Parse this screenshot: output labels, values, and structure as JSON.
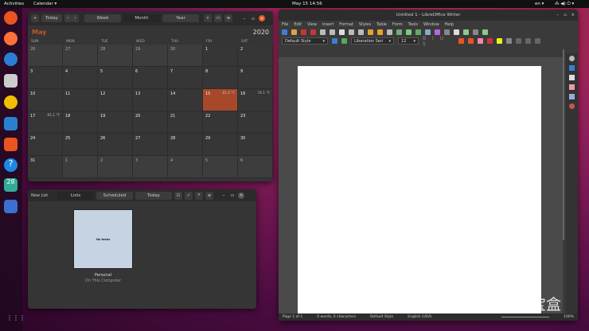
{
  "topbar": {
    "activities": "Activities",
    "app_menu": "Calendar ▾",
    "clock": "May 15  14:56",
    "lang": "en ▾",
    "system_icons": "⁂ ◀) ⏻ ▾"
  },
  "dock": {
    "items": [
      "ubuntu-software",
      "firefox",
      "thunderbird",
      "files",
      "rhythmbox",
      "writer",
      "software-center",
      "help",
      "calendar",
      "tasks"
    ],
    "apps_grid": "⋮⋮⋮"
  },
  "calendar": {
    "add": "+",
    "today": "Today",
    "prev": "‹",
    "next": "›",
    "views": [
      "Week",
      "Month",
      "Year"
    ],
    "active_view": "Month",
    "month": "May",
    "year": "2020",
    "weekdays": [
      "SUN",
      "MON",
      "TUE",
      "WED",
      "THU",
      "FRI",
      "SAT"
    ],
    "weeks": [
      [
        "26",
        "27",
        "28",
        "29",
        "30",
        "1",
        "2"
      ],
      [
        "3",
        "4",
        "5",
        "6",
        "7",
        "8",
        "9"
      ],
      [
        "10",
        "11",
        "12",
        "13",
        "14",
        "15",
        "16"
      ],
      [
        "17",
        "18",
        "19",
        "20",
        "21",
        "22",
        "23"
      ],
      [
        "24",
        "25",
        "26",
        "27",
        "28",
        "29",
        "30"
      ],
      [
        "31",
        "1",
        "2",
        "3",
        "4",
        "5",
        "6"
      ]
    ],
    "weather": {
      "15": "81.0 °F",
      "16": "74.1 °F",
      "17": "65.1 °F"
    },
    "today_day": "15",
    "accent": "#a8482a"
  },
  "tasks": {
    "new_list": "New List",
    "tabs": [
      "Lists",
      "Scheduled",
      "Today"
    ],
    "active_tab": "Lists",
    "card_text": "No tasks",
    "list_name": "Personal",
    "list_source": "On This Computer"
  },
  "writer": {
    "title": "Untitled 1 - LibreOffice Writer",
    "menu": [
      "File",
      "Edit",
      "View",
      "Insert",
      "Format",
      "Styles",
      "Table",
      "Form",
      "Tools",
      "Window",
      "Help"
    ],
    "para_style": "Default Style",
    "font": "Liberation Seri",
    "size": "12",
    "status": {
      "page": "Page 1 of 1",
      "words": "0 words, 0 characters",
      "style": "Default Style",
      "lang": "English (USA)",
      "zoom": "100%"
    }
  },
  "watermark": "知乎 @奇技宝盒"
}
